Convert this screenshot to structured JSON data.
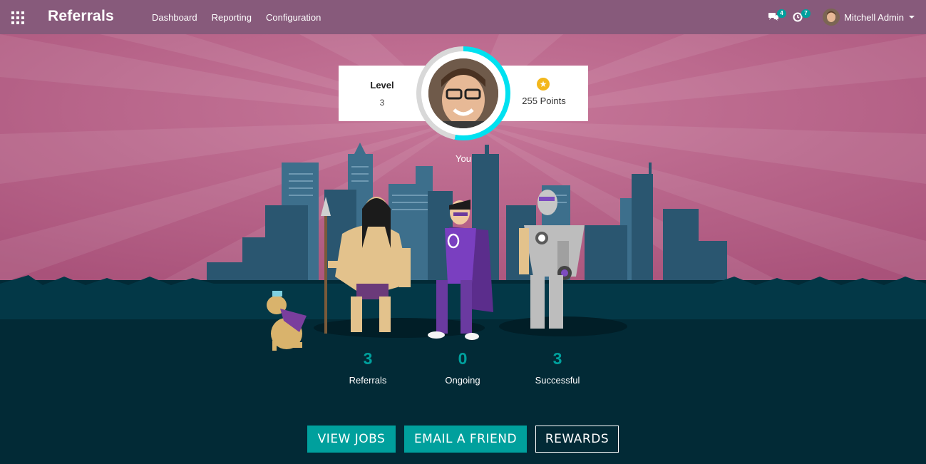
{
  "nav": {
    "app_title": "Referrals",
    "menu": [
      "Dashboard",
      "Reporting",
      "Configuration"
    ],
    "messages_count": "4",
    "activities_count": "7",
    "user_name": "Mitchell Admin"
  },
  "profile": {
    "level_label": "Level",
    "level_value": "3",
    "points": "255 Points",
    "you_label": "You"
  },
  "stats": [
    {
      "value": "3",
      "label": "Referrals"
    },
    {
      "value": "0",
      "label": "Ongoing"
    },
    {
      "value": "3",
      "label": "Successful"
    }
  ],
  "actions": {
    "view_jobs": "VIEW JOBS",
    "email_friend": "EMAIL A FRIEND",
    "rewards": "REWARDS"
  },
  "colors": {
    "navbar": "#875a7b",
    "accent": "#00a09d",
    "sky": "#b0577f",
    "ground": "#022a36",
    "level_ring": "#00e1f0"
  }
}
